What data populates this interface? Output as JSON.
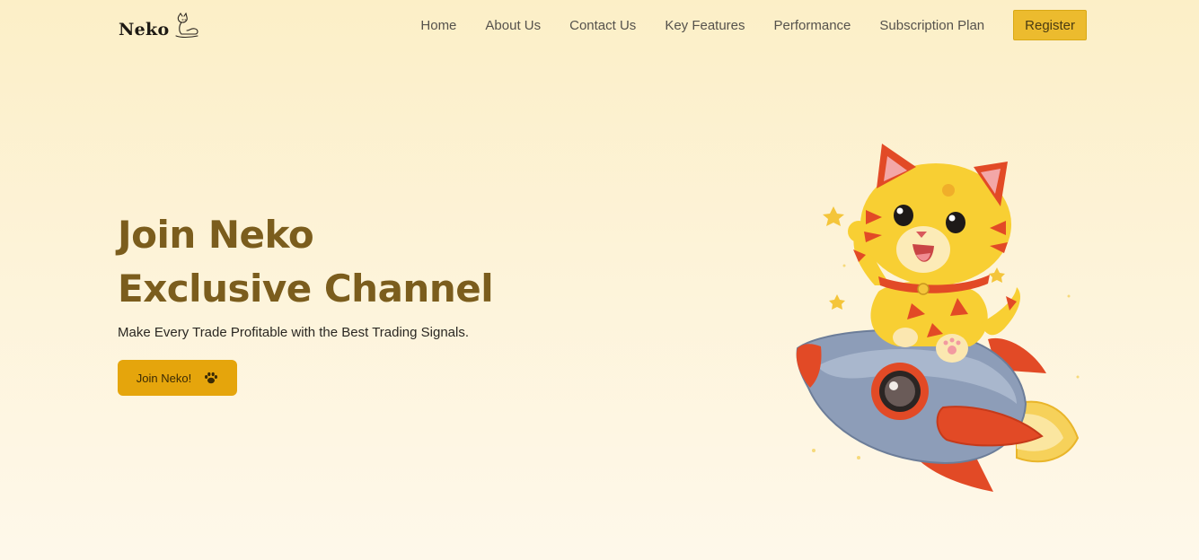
{
  "brand": {
    "name": "Neko"
  },
  "nav": {
    "links": [
      "Home",
      "About Us",
      "Contact Us",
      "Key Features",
      "Performance",
      "Subscription Plan"
    ],
    "register_label": "Register"
  },
  "hero": {
    "title_line1": "Join Neko",
    "title_line2": "Exclusive Channel",
    "subtitle": "Make Every Trade Profitable with the Best Trading Signals.",
    "cta_label": "Join Neko!"
  },
  "colors": {
    "accent": "#ecbb2e",
    "cta": "#e5a50c",
    "title": "#7b5d1d"
  },
  "icons": [
    "cat-logo-icon",
    "paw-icon"
  ]
}
